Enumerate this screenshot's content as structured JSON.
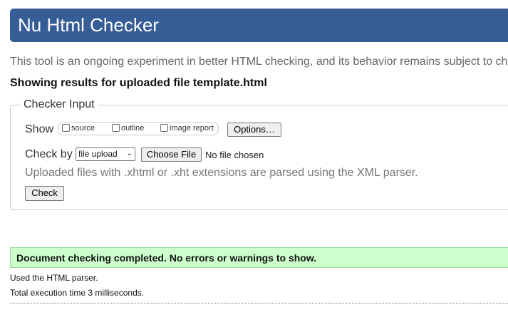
{
  "banner": {
    "title": "Nu Html Checker"
  },
  "intro_text": "This tool is an ongoing experiment in better HTML checking, and its behavior remains subject to ch",
  "results_heading": "Showing results for uploaded file template.html",
  "checker_input": {
    "legend": "Checker Input",
    "show_label": "Show",
    "show_options": [
      {
        "label": "source",
        "checked": false
      },
      {
        "label": "outline",
        "checked": false
      },
      {
        "label": "image report",
        "checked": false
      }
    ],
    "options_button": "Options…",
    "check_by_label": "Check by",
    "check_by_selected": "file upload",
    "choose_file_button": "Choose File",
    "no_file_text": "No file chosen",
    "help_text": "Uploaded files with .xhtml or .xht extensions are parsed using the XML parser.",
    "check_button": "Check"
  },
  "result": {
    "success_message": "Document checking completed. No errors or warnings to show.",
    "parser_note": "Used the HTML parser.",
    "execution_time": "Total execution time 3 milliseconds."
  },
  "colors": {
    "banner_bg": "#365d95",
    "success_bg": "#ccffcc",
    "muted_text": "#666666"
  }
}
